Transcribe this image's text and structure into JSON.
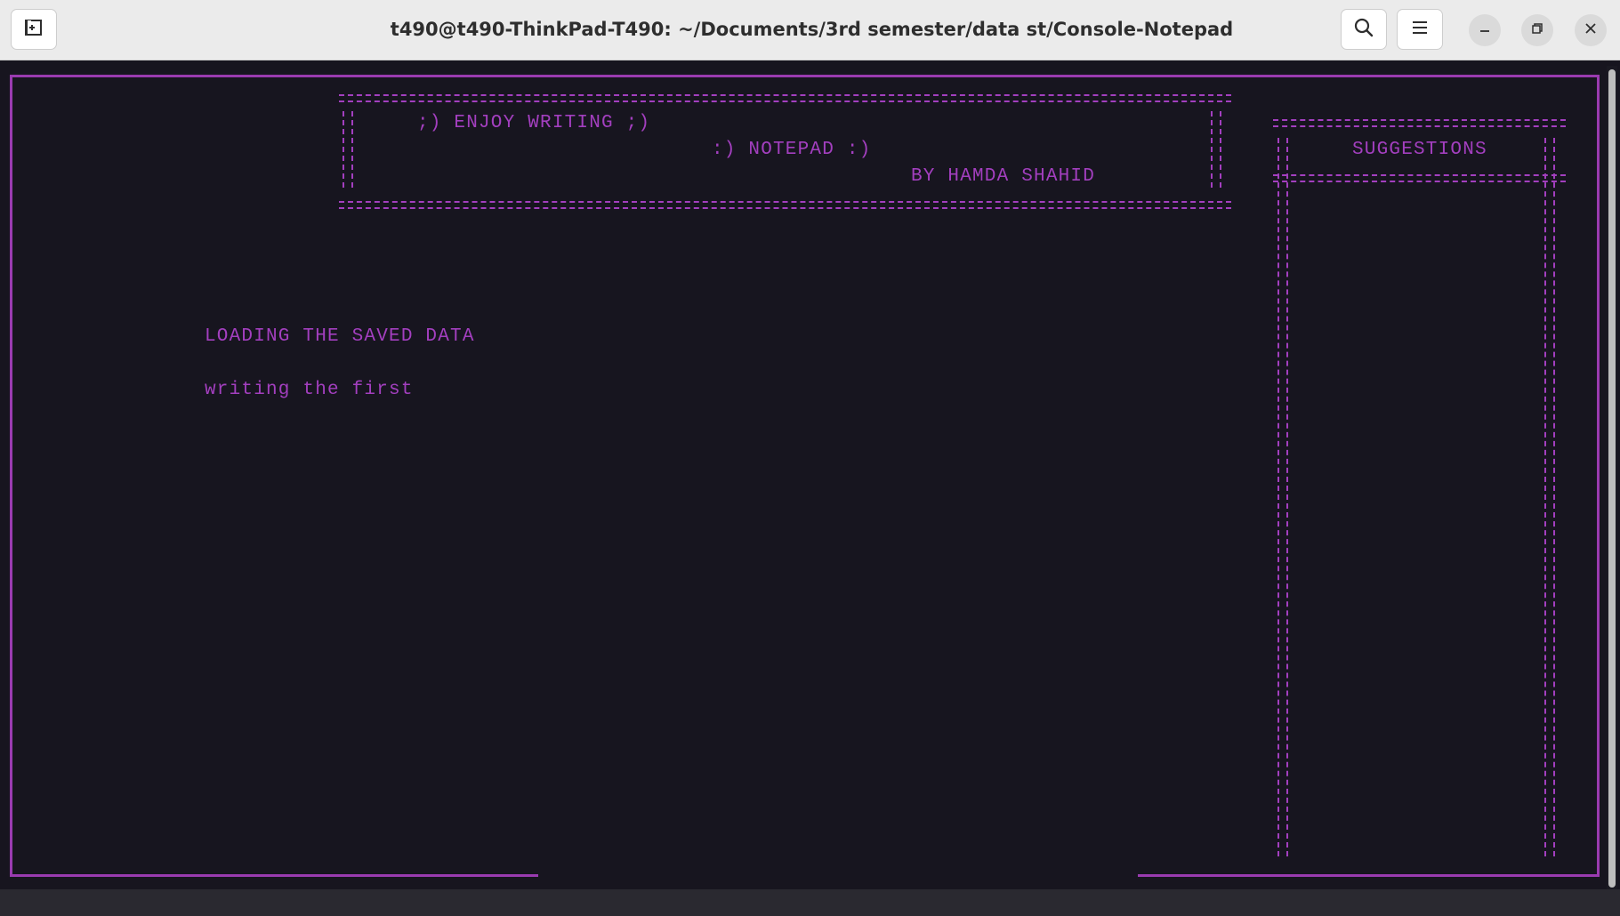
{
  "window": {
    "title": "t490@t490-ThinkPad-T490: ~/Documents/3rd semester/data st/Console-Notepad"
  },
  "header_icons": {
    "new_tab": "new-tab-icon",
    "search": "search-icon",
    "menu": "hamburger-menu-icon",
    "minimize": "minimize-icon",
    "maximize": "maximize-icon",
    "close": "close-icon"
  },
  "banner": {
    "line1": ";) ENJOY WRITING ;)",
    "line2": ":) NOTEPAD :)",
    "line3": "BY HAMDA SHAHID",
    "border_left": "||",
    "border_right": "||"
  },
  "suggestions": {
    "title": "SUGGESTIONS",
    "border": "||"
  },
  "content": {
    "status": "LOADING THE SAVED DATA",
    "text": "writing the first"
  },
  "colors": {
    "accent": "#a33fbf",
    "background": "#17151f",
    "headerbar": "#ebebeb"
  }
}
